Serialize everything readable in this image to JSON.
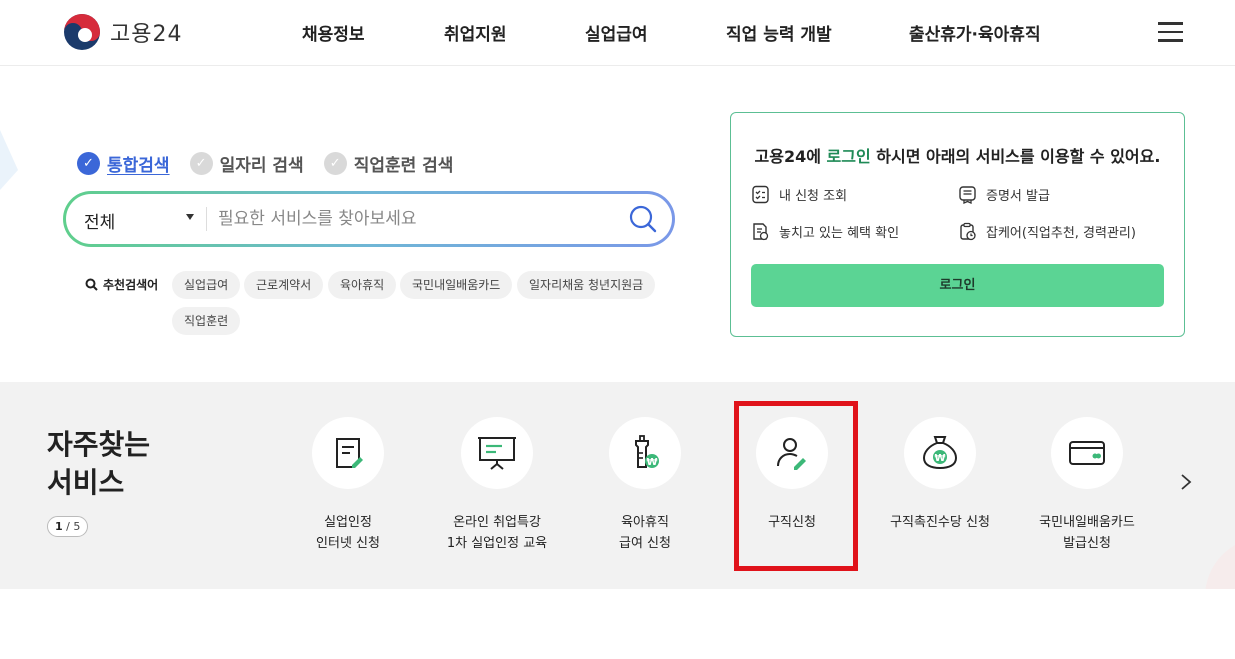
{
  "header": {
    "logo_text": "고용24",
    "nav": [
      "채용정보",
      "취업지원",
      "실업급여",
      "직업 능력 개발",
      "출산휴가·육아휴직"
    ]
  },
  "search": {
    "tabs": [
      {
        "label": "통합검색",
        "active": true
      },
      {
        "label": "일자리 검색",
        "active": false
      },
      {
        "label": "직업훈련 검색",
        "active": false
      }
    ],
    "scope": "전체",
    "placeholder": "필요한 서비스를 찾아보세요",
    "recommend_label": "추천검색어",
    "chips": [
      "실업급여",
      "근로계약서",
      "육아휴직",
      "국민내일배움카드",
      "일자리채움 청년지원금",
      "직업훈련"
    ]
  },
  "login_box": {
    "msg_prefix": "고용24에 ",
    "msg_em": "로그인",
    "msg_suffix": " 하시면 아래의 서비스를 이용할 수 있어요.",
    "items": [
      "내 신청 조회",
      "증명서 발급",
      "놓치고 있는 혜택 확인",
      "잡케어(직업추천, 경력관리)"
    ],
    "button": "로그인"
  },
  "frequent": {
    "title_line1": "자주찾는",
    "title_line2": "서비스",
    "pager_current": "1",
    "pager_sep": " / ",
    "pager_total": "5",
    "services": [
      {
        "label": "실업인정\n인터넷 신청",
        "icon": "document-pen-icon"
      },
      {
        "label": "온라인 취업특강\n1차 실업인정 교육",
        "icon": "presentation-board-icon"
      },
      {
        "label": "육아휴직\n급여 신청",
        "icon": "baby-bottle-won-icon"
      },
      {
        "label": "구직신청",
        "icon": "person-pen-icon"
      },
      {
        "label": "구직촉진수당 신청",
        "icon": "money-bag-won-icon"
      },
      {
        "label": "국민내일배움카드\n발급신청",
        "icon": "card-icon"
      }
    ]
  },
  "colors": {
    "accent_blue": "#3b67d8",
    "accent_green": "#5bd494",
    "highlight_red": "#e0131b"
  }
}
